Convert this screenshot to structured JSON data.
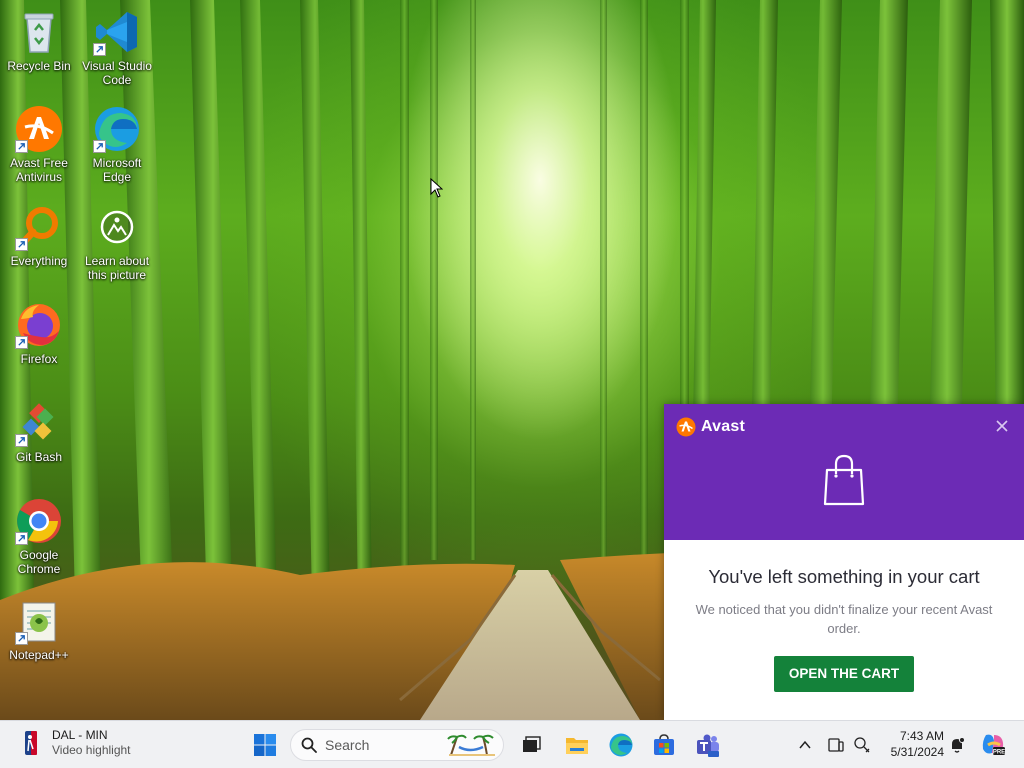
{
  "desktop": {
    "icons": [
      {
        "label": "Recycle Bin",
        "icon": "recycle-bin-icon"
      },
      {
        "label": "Visual Studio Code",
        "icon": "vscode-icon"
      },
      {
        "label": "Avast Free Antivirus",
        "icon": "avast-icon"
      },
      {
        "label": "Microsoft Edge",
        "icon": "edge-icon"
      },
      {
        "label": "Everything",
        "icon": "everything-search-icon"
      },
      {
        "label": "Learn about this picture",
        "icon": "learn-picture-icon"
      },
      {
        "label": "Firefox",
        "icon": "firefox-icon"
      },
      {
        "label": "Git Bash",
        "icon": "git-bash-icon"
      },
      {
        "label": "Google Chrome",
        "icon": "chrome-icon"
      },
      {
        "label": "Notepad++",
        "icon": "notepadpp-icon"
      }
    ]
  },
  "popup": {
    "brand": "Avast",
    "title": "You've left something in your cart",
    "description": "We noticed that you didn't finalize your recent Avast order.",
    "cta_label": "OPEN THE CART",
    "colors": {
      "header": "#6c2bb5",
      "cta": "#14823a"
    }
  },
  "taskbar": {
    "news": {
      "title": "DAL - MIN",
      "subtitle": "Video highlight",
      "icon": "nba-icon"
    },
    "search": {
      "placeholder": "Search"
    },
    "pinned": [
      {
        "name": "start-button",
        "icon": "windows-logo-icon"
      },
      {
        "name": "task-view-button",
        "icon": "task-view-icon"
      },
      {
        "name": "file-explorer-button",
        "icon": "folder-icon"
      },
      {
        "name": "edge-button",
        "icon": "edge-icon"
      },
      {
        "name": "store-button",
        "icon": "store-icon"
      },
      {
        "name": "teams-button",
        "icon": "teams-icon"
      }
    ],
    "clock": {
      "time": "7:43 AM",
      "date": "5/31/2024"
    }
  }
}
